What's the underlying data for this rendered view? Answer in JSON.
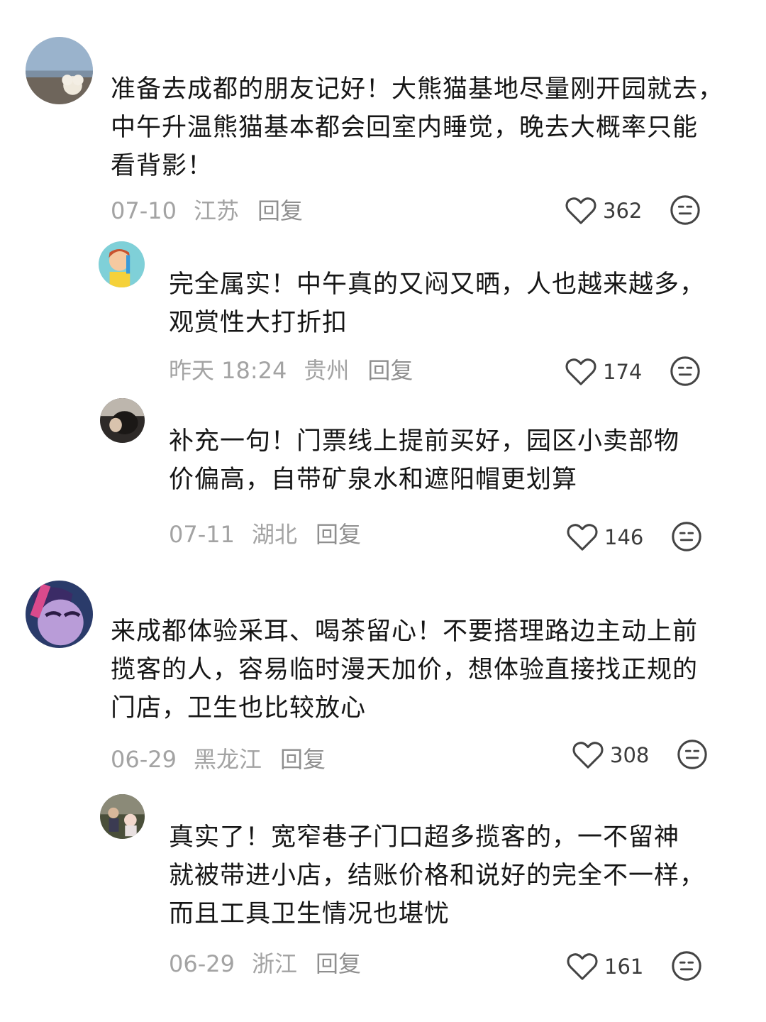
{
  "comments": [
    {
      "text": "准备去成都的朋友记好！大熊猫基地尽量刚开园就去，\n中午升温熊猫基本都会回室内睡觉，晚去大概率只能\n看背影！",
      "date": "07-10",
      "region": "江苏",
      "reply_label": "回复",
      "likes": "362",
      "avatar_icon": "landscape-dog-avatar"
    },
    {
      "text": "完全属实！中午真的又闷又晒，人也越来越多，\n观赏性大打折扣",
      "date": "昨天 18:24",
      "region": "贵州",
      "reply_label": "回复",
      "likes": "174",
      "avatar_icon": "cartoon-boy-avatar"
    },
    {
      "text": "补充一句！门票线上提前买好，园区小卖部物\n价偏高，自带矿泉水和遮阳帽更划算",
      "date": "07-11",
      "region": "湖北",
      "reply_label": "回复",
      "likes": "146",
      "avatar_icon": "dark-photo-avatar"
    },
    {
      "text": "来成都体验采耳、喝茶留心！不要搭理路边主动上前\n揽客的人，容易临时漫天加价，想体验直接找正规的\n门店，卫生也比较放心",
      "date": "06-29",
      "region": "黑龙江",
      "reply_label": "回复",
      "likes": "308",
      "avatar_icon": "purple-pony-avatar"
    },
    {
      "text": "真实了！宽窄巷子门口超多揽客的，一不留神\n就被带进小店，结账价格和说好的完全不一样，\n而且工具卫生情况也堪忧",
      "date": "06-29",
      "region": "浙江",
      "reply_label": "回复",
      "likes": "161",
      "avatar_icon": "outdoor-photo-avatar"
    }
  ],
  "icons": {
    "like": "heart-outline-icon",
    "dislike": "neutral-face-icon"
  },
  "colors": {
    "text": "#161616",
    "meta": "#a3a3a3",
    "icon": "#444444"
  }
}
